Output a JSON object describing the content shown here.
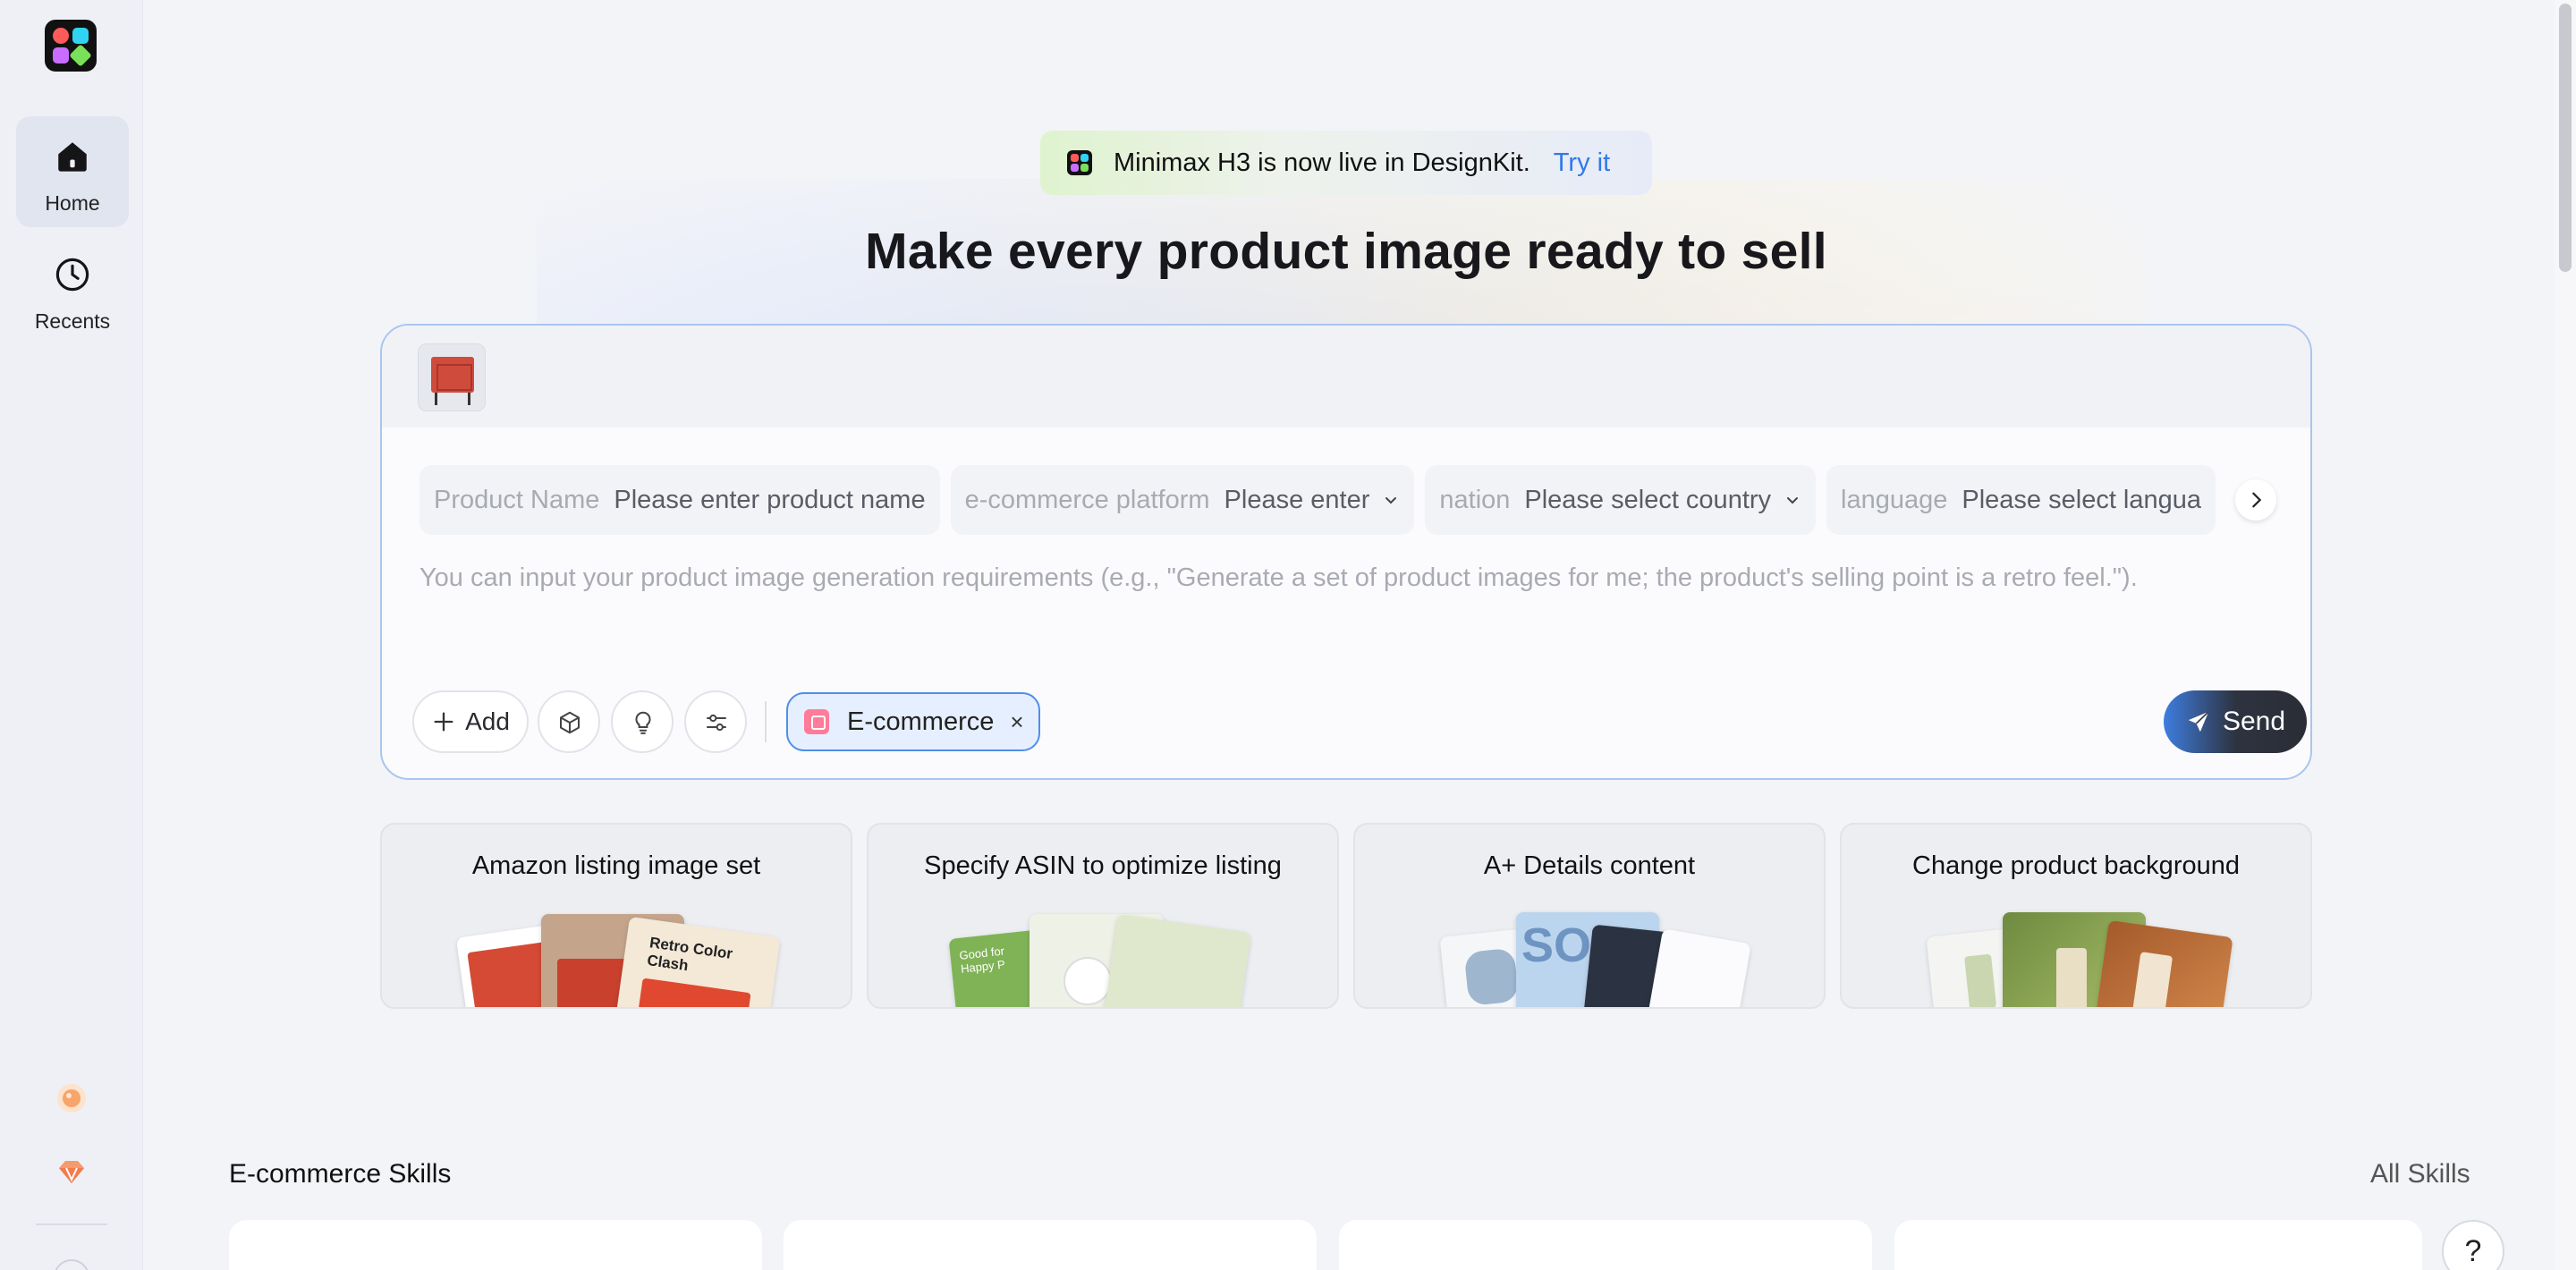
{
  "sidebar": {
    "items": [
      {
        "label": "Home",
        "icon": "home-icon",
        "active": true
      },
      {
        "label": "Recents",
        "icon": "clock-icon",
        "active": false
      }
    ]
  },
  "announcement": {
    "text": "Minimax H3 is now live in DesignKit.",
    "link": "Try it"
  },
  "hero": {
    "title": "Make every product image ready to sell"
  },
  "composer": {
    "fields": [
      {
        "label": "Product Name",
        "value": "Please enter product name",
        "dropdown": false
      },
      {
        "label": "e-commerce platform",
        "value": "Please enter",
        "dropdown": true
      },
      {
        "label": "nation",
        "value": "Please select country",
        "dropdown": true
      },
      {
        "label": "language",
        "value": "Please select langua",
        "dropdown": false
      }
    ],
    "placeholder": "You can input your product image generation requirements (e.g., \"Generate a set of product images for me; the product's selling point is a retro feel.\").",
    "add_label": "Add",
    "chip_label": "E-commerce",
    "chip_close": "×",
    "send_label": "Send"
  },
  "cards": [
    {
      "title": "Amazon listing image set",
      "art_text": "Retro Color Clash"
    },
    {
      "title": "Specify ASIN to optimize listing",
      "art_text": "Good for Happy P"
    },
    {
      "title": "A+ Details content",
      "art_text": "SO"
    },
    {
      "title": "Change product background",
      "art_text": ""
    }
  ],
  "skills": {
    "title": "E-commerce Skills",
    "all_label": "All Skills"
  },
  "help": {
    "label": "?"
  },
  "colors": {
    "accent": "#2f79e8",
    "chip_border": "#4f8fe8",
    "composer_border": "#a9c5ef"
  }
}
